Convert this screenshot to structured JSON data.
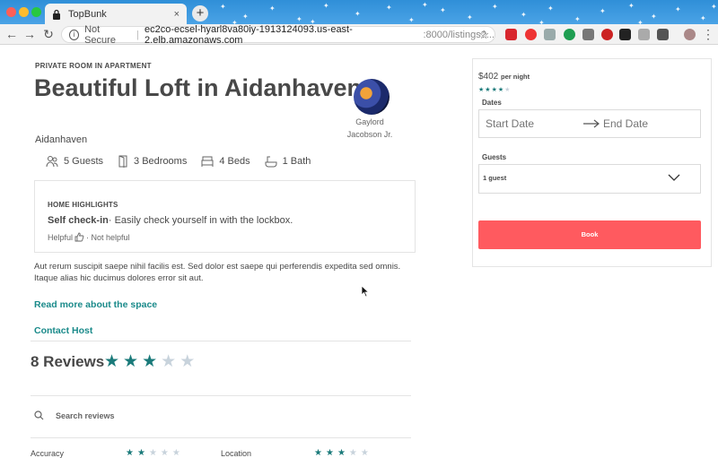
{
  "browser": {
    "tab_title": "TopBunk",
    "tab_close": "×",
    "new_tab": "+",
    "security_label": "Not Secure",
    "url_host": "ec2co-ecsel-hyarl8va80iy-1913124093.us-east-2.elb.amazonaws.com",
    "url_path": ":8000/listings?...",
    "colors": {
      "tab_strip": "#2f8fd8",
      "toolbar": "#f2f2f2"
    }
  },
  "listing": {
    "room_type": "PRIVATE ROOM IN APARTMENT",
    "title": "Beautiful Loft in Aidanhaven",
    "host_first": "Gaylord",
    "host_last": "Jacobson Jr.",
    "city": "Aidanhaven",
    "amenities": {
      "guests": "5 Guests",
      "bedrooms": "3 Bedrooms",
      "beds": "4 Beds",
      "baths": "1 Bath"
    },
    "highlights": {
      "label": "HOME HIGHLIGHTS",
      "title": "Self check-in",
      "text": "· Easily check yourself in with the lockbox.",
      "helpful": "Helpful",
      "not_helpful": "· Not helpful"
    },
    "description": "Aut rerum suscipit saepe nihil facilis est. Sed dolor est saepe qui perferendis expedita sed omnis. Itaque alias hic ducimus dolores error sit aut.",
    "read_more": "Read more about the space",
    "contact_host": "Contact Host"
  },
  "reviews": {
    "title": "8 Reviews",
    "rating": 3,
    "max_rating": 5,
    "search_placeholder": "Search reviews",
    "categories": [
      {
        "label": "Accuracy",
        "rating": 2
      },
      {
        "label": "Location",
        "rating": 3
      }
    ]
  },
  "booking": {
    "price": "$402",
    "per_night": "per night",
    "rating": 4,
    "max_rating": 5,
    "dates_label": "Dates",
    "start_placeholder": "Start Date",
    "end_placeholder": "End Date",
    "guests_label": "Guests",
    "guests_value": "1 guest",
    "book_label": "Book",
    "book_color": "#ff5a5f"
  },
  "colors": {
    "accent": "#1a8a8a",
    "star_on": "#1a7a7a",
    "star_off": "#c8d3dc"
  }
}
